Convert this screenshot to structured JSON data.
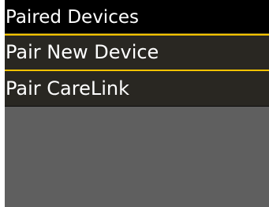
{
  "header": {
    "title": "Paired Devices"
  },
  "menu": {
    "items": [
      {
        "label": "Pair New Device",
        "selected": true
      },
      {
        "label": "Pair CareLink",
        "selected": false
      }
    ]
  },
  "colors": {
    "selection_accent": "#f2c200",
    "title_background": "#000000",
    "item_background": "#292722",
    "screen_background": "#5f5f5f",
    "text": "#ffffff"
  }
}
